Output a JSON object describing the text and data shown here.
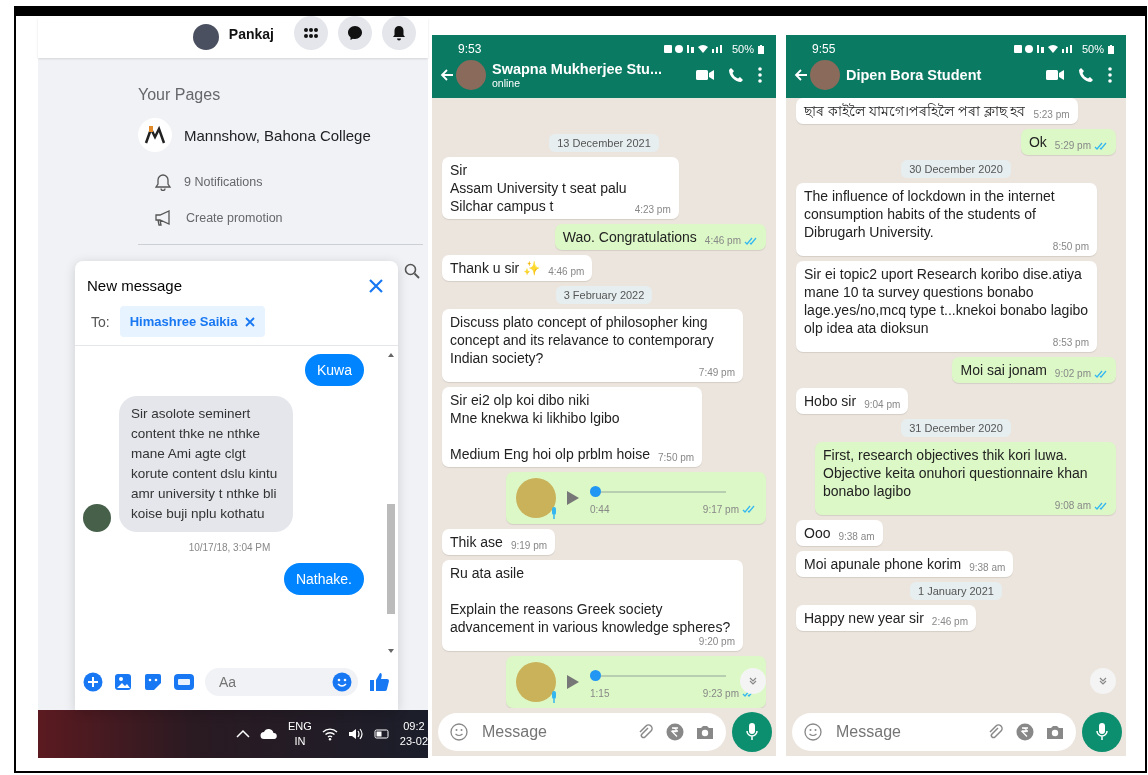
{
  "facebook": {
    "profile_name": "Pankaj",
    "your_pages": {
      "heading": "Your Pages",
      "page_name": "Mannshow, Bahona College",
      "actions": [
        {
          "kind": "notifications",
          "label": "9 Notifications"
        },
        {
          "kind": "promotion",
          "label": "Create promotion"
        }
      ]
    },
    "new_message": {
      "title": "New message",
      "to_label": "To:",
      "recipient": "Himashree Saikia",
      "messages": [
        {
          "kind": "sent",
          "text": "Kuwa"
        },
        {
          "kind": "received",
          "text": "Sir asolote seminert content thke ne nthke mane Ami agte clgt korute content dslu kintu amr university t nthke bli koise buji nplu kothatu"
        },
        {
          "kind": "timestamp",
          "text": "10/17/18, 3:04 PM"
        },
        {
          "kind": "sent",
          "text": "Nathake."
        }
      ],
      "composer_placeholder": "Aa"
    },
    "taskbar": {
      "language": "ENG",
      "region": "IN",
      "time": "09:2",
      "date": "23-02"
    }
  },
  "chats": [
    {
      "status_time": "9:53",
      "battery": "50%",
      "contact": "Swapna Mukherjee Stu...",
      "subtitle": "online",
      "composer_placeholder": "Message",
      "messages": [
        {
          "kind": "date",
          "text": "13 December 2021"
        },
        {
          "kind": "in",
          "text": "Sir\nAssam University t seat palu\nSilchar campus t",
          "time": "4:23 pm"
        },
        {
          "kind": "out",
          "text": "Wao. Congratulations",
          "time": "4:46 pm",
          "read": true
        },
        {
          "kind": "in",
          "text": "Thank u sir ✨",
          "time": "4:46 pm"
        },
        {
          "kind": "date",
          "text": "3 February 2022"
        },
        {
          "kind": "in",
          "text": "Discuss plato concept of philosopher king concept and its relavance to contemporary Indian society?",
          "time": "7:49 pm"
        },
        {
          "kind": "in",
          "text": "Sir ei2 olp koi dibo niki\nMne knekwa ki likhibo lgibo\n\nMedium Eng hoi olp prblm hoise",
          "time": "7:50 pm"
        },
        {
          "kind": "voice",
          "duration": "0:44",
          "time": "9:17 pm",
          "read": true,
          "level": 0
        },
        {
          "kind": "in",
          "text": "Thik ase",
          "time": "9:19 pm"
        },
        {
          "kind": "in",
          "text": "Ru ata asile\n\nExplain the reasons Greek society advancement in various knowledge spheres?",
          "time": "9:20 pm"
        },
        {
          "kind": "voice",
          "duration": "1:15",
          "time": "9:23 pm",
          "read": true,
          "level": 0
        }
      ]
    },
    {
      "status_time": "9:55",
      "battery": "50%",
      "contact": "Dipen Bora Student",
      "composer_placeholder": "Message",
      "messages": [
        {
          "kind": "in",
          "text": "ছাৰ কাইলৈ যামগে।পৰহিলৈ পৰা ক্লাছ হব",
          "time": "5:23 pm"
        },
        {
          "kind": "out",
          "text": "Ok",
          "time": "5:29 pm",
          "read": true
        },
        {
          "kind": "date",
          "text": "30 December 2020"
        },
        {
          "kind": "in",
          "text": "The influence of lockdown in the internet consumption habits of the students of Dibrugarh University.",
          "time": "8:50 pm"
        },
        {
          "kind": "in",
          "text": "Sir ei topic2 uport  Research koribo dise.atiya mane 10 ta survey questions bonabo lage.yes/no,mcq type t...knekoi bonabo lagibo olp idea ata dioksun",
          "time": "8:53 pm"
        },
        {
          "kind": "out",
          "text": "Moi sai jonam",
          "time": "9:02 pm",
          "read": true
        },
        {
          "kind": "in",
          "text": "Hobo sir",
          "time": "9:04 pm"
        },
        {
          "kind": "date",
          "text": "31 December 2020"
        },
        {
          "kind": "out",
          "text": "First, research objectives thik kori luwa. Objective keita onuhori questionnaire khan bonabo lagibo",
          "time": "9:08 am",
          "read": true
        },
        {
          "kind": "in",
          "text": "Ooo",
          "time": "9:38 am"
        },
        {
          "kind": "in",
          "text": "Moi apunale phone korim",
          "time": "9:38 am"
        },
        {
          "kind": "date",
          "text": "1 January 2021"
        },
        {
          "kind": "in",
          "text": "Happy new year sir",
          "time": "2:46 pm"
        }
      ]
    }
  ]
}
